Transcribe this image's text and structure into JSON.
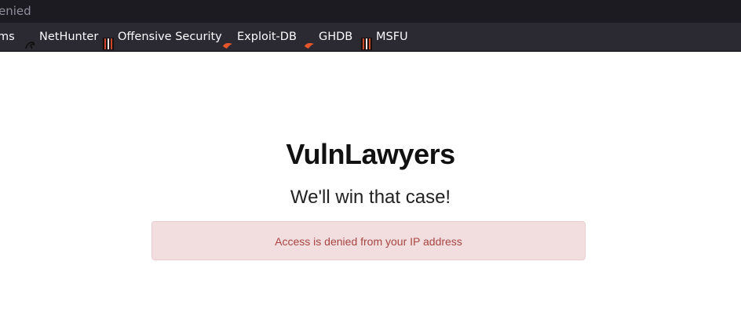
{
  "window": {
    "title_fragment": "enied"
  },
  "bookmarks_bar": {
    "items": [
      {
        "label": "ms",
        "icon": "none"
      },
      {
        "label": "NetHunter",
        "icon": "kali-dragon-icon"
      },
      {
        "label": "Offensive Security",
        "icon": "offsec-icon"
      },
      {
        "label": "Exploit-DB",
        "icon": "exploit-db-icon"
      },
      {
        "label": "GHDB",
        "icon": "ghdb-icon"
      },
      {
        "label": "MSFU",
        "icon": "msfu-icon"
      }
    ]
  },
  "page": {
    "title": "VulnLawyers",
    "subtitle": "We'll win that case!",
    "alert_message": "Access is denied from your IP address"
  },
  "colors": {
    "titlebar_bg": "#1c1b22",
    "bookmarks_bg": "#2b2a33",
    "alert_bg": "#f2dedf",
    "alert_border": "#ebccd1",
    "alert_text": "#a94442",
    "exploit_orange": "#e8552a"
  }
}
